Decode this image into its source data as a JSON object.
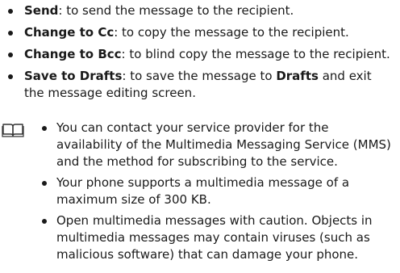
{
  "options": [
    {
      "term": "Send",
      "desc": ": to send the message to the recipient."
    },
    {
      "term": "Change to Cc",
      "desc": ": to copy the message to the recipient."
    },
    {
      "term": "Change to Bcc",
      "desc": ": to blind copy the message to the recipient."
    },
    {
      "term": "Save to Drafts",
      "desc_before": ": to save the message to ",
      "desc_bold": "Drafts",
      "desc_after": " and exit the message editing screen."
    }
  ],
  "note": {
    "icon": "book-icon",
    "items": [
      "You can contact your service provider for the availability of the Multimedia Messaging Service (MMS) and the method for subscribing to the service.",
      "Your phone supports a multimedia message of a maximum size of 300 KB.",
      "Open multimedia messages with caution. Objects in multimedia messages may contain viruses (such as malicious software) that can damage your phone."
    ]
  }
}
